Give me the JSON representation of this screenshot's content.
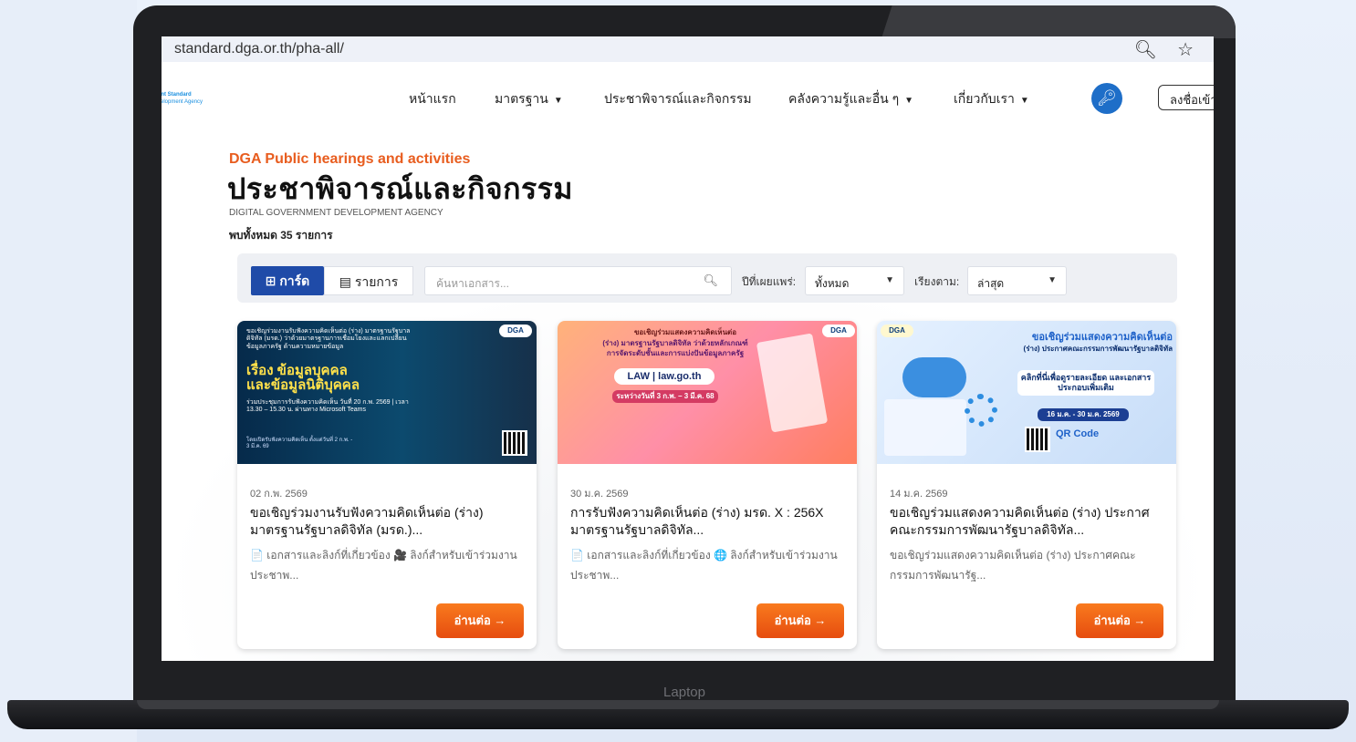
{
  "device": {
    "label": "Laptop"
  },
  "browser": {
    "url": "standard.dga.or.th/pha-all/",
    "zoom_icon": "magnifier-minus-icon",
    "star_icon": "star-icon"
  },
  "logo": {
    "line1": "ent Standard",
    "line2": "velopment Agency"
  },
  "nav": {
    "items": [
      {
        "label": "หน้าแรก",
        "dropdown": false
      },
      {
        "label": "มาตรฐาน",
        "dropdown": true
      },
      {
        "label": "ประชาพิจารณ์และกิจกรรม",
        "dropdown": false
      },
      {
        "label": "คลังความรู้และอื่น ๆ",
        "dropdown": true
      },
      {
        "label": "เกี่ยวกับเรา",
        "dropdown": true
      }
    ],
    "key_icon": "key-icon",
    "login_label": "ลงชื่อเข้าใ"
  },
  "header": {
    "en_title": "DGA Public hearings and activities",
    "th_title": "ประชาพิจารณ์และกิจกรรม",
    "agency": "DIGITAL GOVERNMENT DEVELOPMENT AGENCY",
    "count": "พบทั้งหมด 35 รายการ"
  },
  "filter": {
    "view_card": "⊞ การ์ด",
    "view_list": "▤ รายการ",
    "search_placeholder": "ค้นหาเอกสาร...",
    "year_label": "ปีที่เผยแพร่:",
    "year_value": "ทั้งหมด",
    "sort_label": "เรียงตาม:",
    "sort_value": "ล่าสุด",
    "accent_color": "#1f4ba8"
  },
  "cards": [
    {
      "img": {
        "top": "ขอเชิญร่วมงานรับฟังความคิดเห็นต่อ (ร่าง) มาตรฐานรัฐบาลดิจิทัล (มรด.) ว่าด้วยมาตรฐานการเชื่อมโยงและแลกเปลี่ยนข้อมูลภาครัฐ ด้านความหมายข้อมูล",
        "headline1": "เรื่อง ข้อมูลบุคคล",
        "headline2": "และข้อมูลนิติบุคคล",
        "detail": "ร่วมประชุมการรับฟังความคิดเห็น วันที่ 20 ก.พ. 2569 | เวลา 13.30 – 15.30 น. ผ่านทาง Microsoft Teams",
        "foot": "โดยเปิดรับฟังความคิดเห็น ตั้งแต่วันที่ 2 ก.พ. - 3 มี.ค. 69",
        "badge": "DGA"
      },
      "date": "02 ก.พ. 2569",
      "title": "ขอเชิญร่วมงานรับฟังความคิดเห็นต่อ (ร่าง) มาตรฐานรัฐบาลดิจิทัล (มรด.)...",
      "desc": "📄 เอกสารและลิงก์ที่เกี่ยวข้อง 🎥 ลิงก์สำหรับเข้าร่วมงานประชาพ...",
      "button": "อ่านต่อ →"
    },
    {
      "img": {
        "top": "ขอเชิญร่วมแสดงความคิดเห็นต่อ",
        "headline1": "(ร่าง) มาตรฐานรัฐบาลดิจิทัล ว่าด้วยหลักเกณฑ์",
        "headline2": "การจัดระดับชั้นและการแบ่งปันข้อมูลภาครัฐ",
        "detail": "LAW | law.go.th",
        "foot": "ระหว่างวันที่ 3 ก.พ. – 3 มี.ค. 68",
        "badge": "DGA"
      },
      "date": "30 ม.ค. 2569",
      "title": "การรับฟังความคิดเห็นต่อ (ร่าง) มรด. X : 256X มาตรฐานรัฐบาลดิจิทัล...",
      "desc": "📄 เอกสารและลิงก์ที่เกี่ยวข้อง 🌐 ลิงก์สำหรับเข้าร่วมงานประชาพ...",
      "button": "อ่านต่อ →"
    },
    {
      "img": {
        "top": "ขอเชิญร่วมแสดงความคิดเห็นต่อ",
        "headline1": "(ร่าง) ประกาศคณะกรรมการพัฒนารัฐบาลดิจิทัล",
        "headline2": "คลิกที่นี่เพื่อดูรายละเอียด และเอกสารประกอบเพิ่มเติม",
        "detail": "16 ม.ค. - 30 ม.ค. 2569",
        "foot": "QR Code",
        "badge": "DGA"
      },
      "date": "14 ม.ค. 2569",
      "title": "ขอเชิญร่วมแสดงความคิดเห็นต่อ (ร่าง) ประกาศคณะกรรมการพัฒนารัฐบาลดิจิทัล...",
      "desc": "ขอเชิญร่วมแสดงความคิดเห็นต่อ (ร่าง) ประกาศคณะกรรมการพัฒนารัฐ...",
      "button": "อ่านต่อ →"
    }
  ],
  "colors": {
    "brand_orange": "#e85d1f",
    "brand_blue": "#1f4ba8"
  }
}
